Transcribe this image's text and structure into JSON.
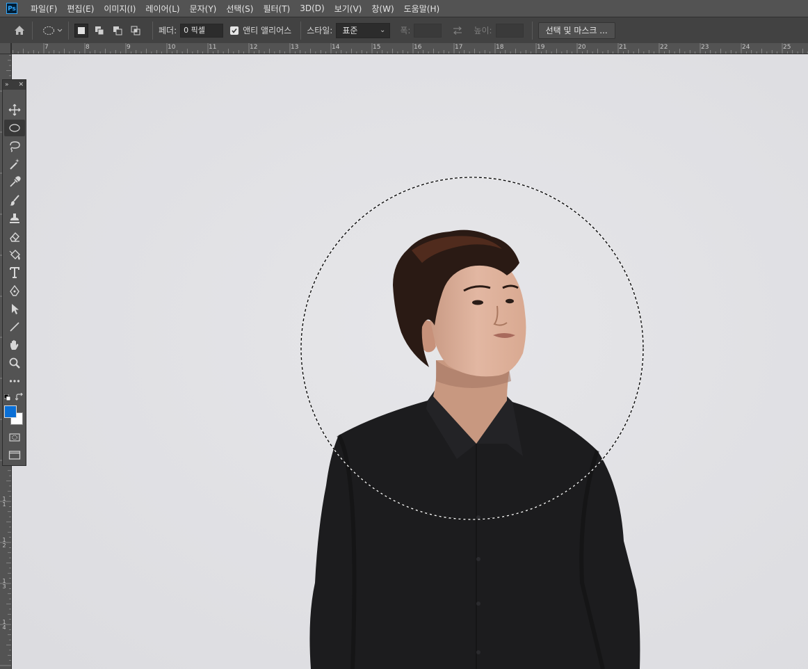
{
  "app": {
    "logo_text": "Ps"
  },
  "menu": [
    "파일(F)",
    "편집(E)",
    "이미지(I)",
    "레이어(L)",
    "문자(Y)",
    "선택(S)",
    "필터(T)",
    "3D(D)",
    "보기(V)",
    "창(W)",
    "도움말(H)"
  ],
  "options": {
    "feather_label": "페더:",
    "feather_value": "0 픽셀",
    "antialias_label": "앤티 앨리어스",
    "antialias_checked": true,
    "style_label": "스타일:",
    "style_value": "표준",
    "width_label": "폭:",
    "height_label": "높이:",
    "select_mask_label": "선택 및 마스크 ..."
  },
  "ruler": {
    "h_numbers": [
      "7",
      "8",
      "9",
      "10",
      "11",
      "12",
      "13",
      "14",
      "15",
      "16",
      "17",
      "18",
      "19",
      "20",
      "21",
      "22",
      "23",
      "24",
      "25"
    ],
    "v_numbers": [
      "1 1",
      "1 2",
      "1 3",
      "1 4"
    ]
  },
  "tools": [
    {
      "name": "move-tool",
      "icon": "move-icon"
    },
    {
      "name": "elliptical-marquee-tool",
      "icon": "ellipse-marquee-icon",
      "active": true
    },
    {
      "name": "lasso-tool",
      "icon": "lasso-icon"
    },
    {
      "name": "magic-wand-tool",
      "icon": "magic-wand-icon"
    },
    {
      "name": "eyedropper-tool",
      "icon": "eyedropper-icon"
    },
    {
      "name": "brush-tool",
      "icon": "brush-icon"
    },
    {
      "name": "clone-stamp-tool",
      "icon": "stamp-icon"
    },
    {
      "name": "eraser-tool",
      "icon": "eraser-icon"
    },
    {
      "name": "paint-bucket-tool",
      "icon": "bucket-icon"
    },
    {
      "name": "type-tool",
      "icon": "type-icon"
    },
    {
      "name": "pen-tool",
      "icon": "pen-icon"
    },
    {
      "name": "path-selection-tool",
      "icon": "arrow-icon"
    },
    {
      "name": "line-tool",
      "icon": "line-icon"
    },
    {
      "name": "hand-tool",
      "icon": "hand-icon"
    },
    {
      "name": "zoom-tool",
      "icon": "zoom-icon"
    },
    {
      "name": "more-tools",
      "icon": "ellipsis-icon"
    }
  ],
  "colors": {
    "foreground": "#0a6fd6",
    "background": "#ffffff",
    "canvas_bg": "#e2e2e5",
    "shirt": "#1c1c1e"
  }
}
